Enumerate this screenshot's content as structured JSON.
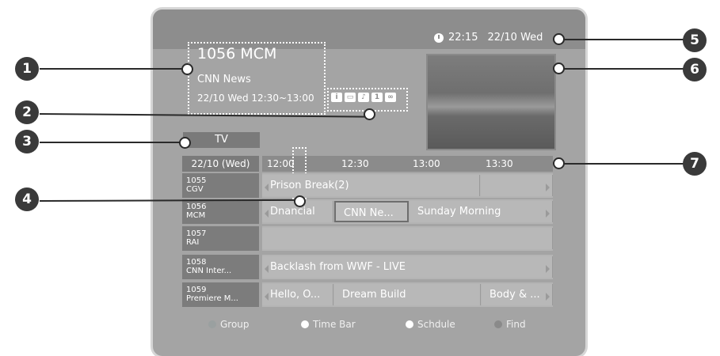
{
  "header": {
    "clock_time": "22:15",
    "clock_date": "22/10 Wed"
  },
  "program_info": {
    "channel": "1056 MCM",
    "title": "CNN News",
    "time": "22/10  Wed  12:30~13:00",
    "icons": [
      "info-icon",
      "subtitle-icon",
      "audio-icon",
      "rating-icon",
      "link-icon"
    ]
  },
  "group_label": "TV",
  "guide": {
    "date": "22/10 (Wed)",
    "times": [
      "12:00",
      "12:30",
      "13:00",
      "13:30"
    ],
    "channels": [
      {
        "number": "1055",
        "name": "CGV",
        "programs": [
          "Prison Break(2)",
          ""
        ]
      },
      {
        "number": "1056",
        "name": "MCM",
        "programs": [
          "Dnancial",
          "CNN Ne...",
          "Sunday Morning"
        ]
      },
      {
        "number": "1057",
        "name": "RAI",
        "programs": [
          ""
        ]
      },
      {
        "number": "1058",
        "name": "CNN Inter...",
        "programs": [
          "Backlash from WWF - LIVE"
        ]
      },
      {
        "number": "1059",
        "name": "Premiere M...",
        "programs": [
          "Hello, O...",
          "Dream Build",
          "Body & ..."
        ]
      }
    ]
  },
  "legend": [
    {
      "label": "Group",
      "color": "#9aa0a0"
    },
    {
      "label": "Time Bar",
      "color": "#ffffff"
    },
    {
      "label": "Schdule",
      "color": "#ffffff"
    },
    {
      "label": "Find",
      "color": "#8a8a8a"
    }
  ],
  "callouts": [
    "1",
    "2",
    "3",
    "4",
    "5",
    "6",
    "7"
  ]
}
